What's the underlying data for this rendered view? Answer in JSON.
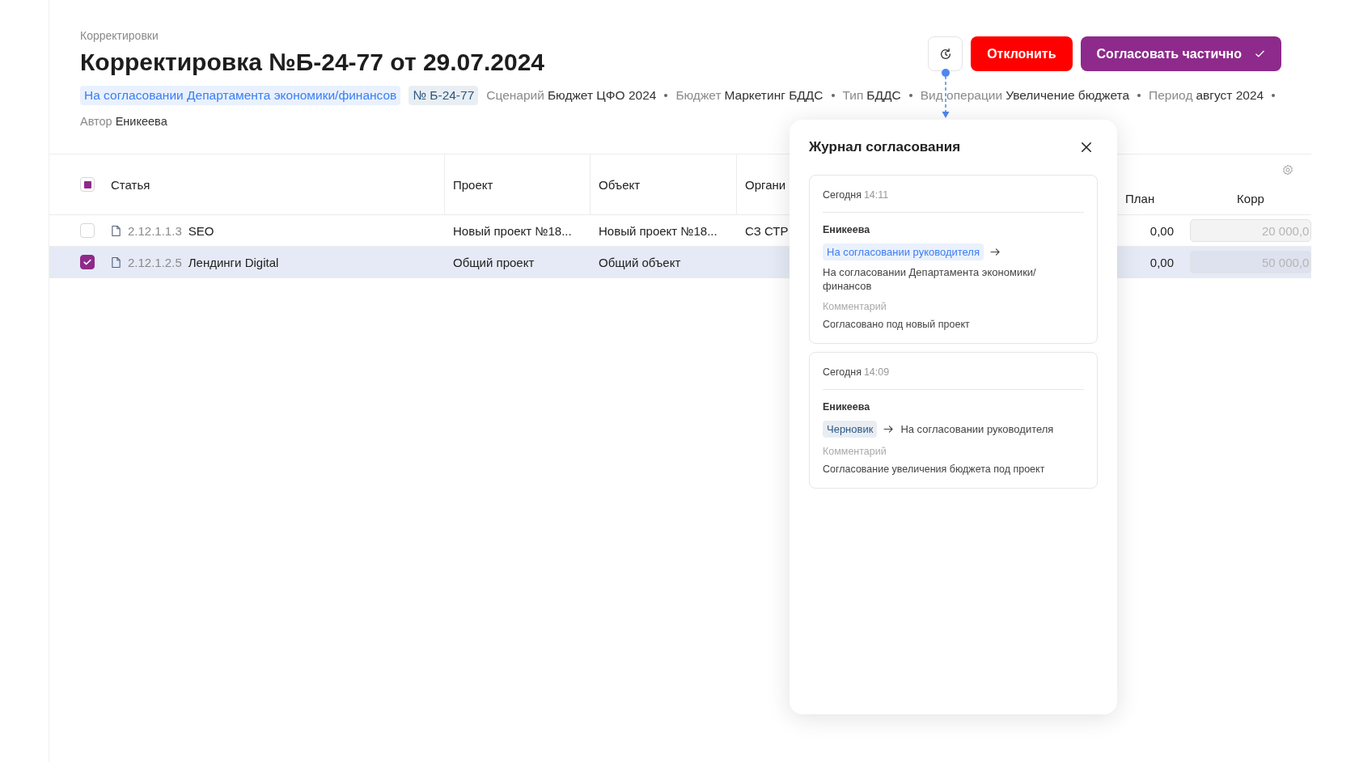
{
  "breadcrumb": "Корректировки",
  "title": "Корректировка №Б-24-77 от 29.07.2024",
  "actions": [
    {
      "label": "Отклонить",
      "kind": "danger"
    },
    {
      "label": "Согласовать частично",
      "kind": "confirm"
    }
  ],
  "status_tag": "На согласовании Департамента экономики/финансов",
  "number_tag": "№ Б-24-77",
  "meta": [
    {
      "label": "Сценарий",
      "value": "Бюджет ЦФО 2024"
    },
    {
      "label": "Бюджет",
      "value": "Маркетинг БДДС"
    },
    {
      "label": "Тип",
      "value": "БДДС"
    },
    {
      "label": "Вид операции",
      "value": "Увеличение бюджета"
    },
    {
      "label": "Период",
      "value": "август 2024"
    }
  ],
  "author": {
    "label": "Автор",
    "value": "Еникеева"
  },
  "table": {
    "select_all": {
      "indeterminate": true
    },
    "columns": [
      "Статья",
      "Проект",
      "Объект",
      "Органи",
      "План",
      "Корр"
    ],
    "rows": [
      {
        "selected": false,
        "code": "2.12.1.1.3",
        "name": "SEO",
        "project": "Новый проект №18...",
        "object": "Новый проект №18...",
        "org": "СЗ СТР",
        "plan": "0,00",
        "correction": "20 000,0"
      },
      {
        "selected": true,
        "code": "2.12.1.2.5",
        "name": "Лендинги Digital",
        "project": "Общий проект",
        "object": "Общий объект",
        "plan": "0,00",
        "correction": "50 000,0"
      }
    ]
  },
  "approval_log": {
    "title": "Журнал согласования",
    "entries": [
      {
        "date": "Сегодня",
        "time": "14:11",
        "author": "Еникеева",
        "from": {
          "label": "На согласовании руководителя",
          "color": "#3d7ef0"
        },
        "to": "На согласовании Департамента экономики/финансов",
        "comment_label": "Комментарий",
        "comment": "Согласовано под новый проект"
      },
      {
        "date": "Сегодня",
        "time": "14:09",
        "author": "Еникеева",
        "from": {
          "label": "Черновик",
          "color": "#2d5a85"
        },
        "to": "На согласовании руководителя",
        "comment_label": "Комментарий",
        "comment": "Согласование увеличения бюджета под проект"
      }
    ]
  }
}
